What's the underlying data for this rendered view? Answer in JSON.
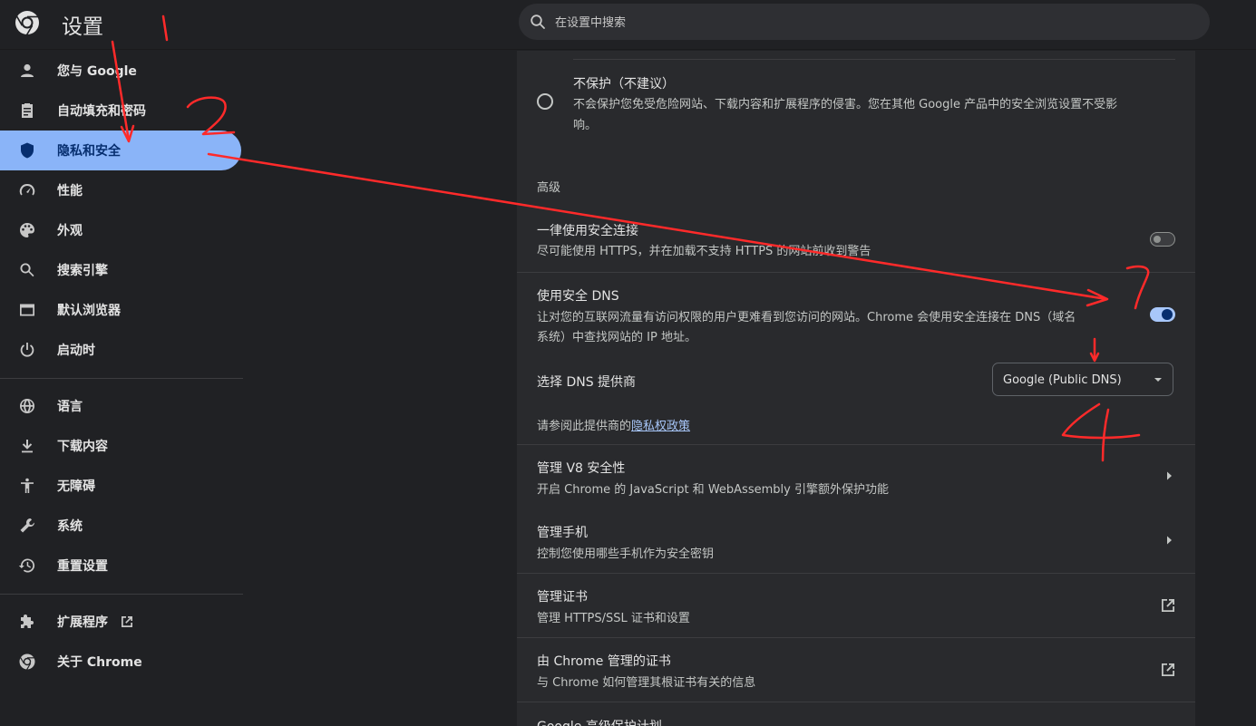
{
  "app": {
    "title": "设置"
  },
  "search": {
    "placeholder": "在设置中搜索"
  },
  "sidebar": {
    "items": [
      {
        "label": "您与 Google",
        "icon": "person-icon"
      },
      {
        "label": "自动填充和密码",
        "icon": "clipboard-icon"
      },
      {
        "label": "隐私和安全",
        "icon": "shield-icon",
        "active": true
      },
      {
        "label": "性能",
        "icon": "speedometer-icon"
      },
      {
        "label": "外观",
        "icon": "palette-icon"
      },
      {
        "label": "搜索引擎",
        "icon": "search-icon"
      },
      {
        "label": "默认浏览器",
        "icon": "browser-window-icon"
      },
      {
        "label": "启动时",
        "icon": "power-icon"
      }
    ],
    "items2": [
      {
        "label": "语言",
        "icon": "globe-icon"
      },
      {
        "label": "下载内容",
        "icon": "download-icon"
      },
      {
        "label": "无障碍",
        "icon": "accessibility-icon"
      },
      {
        "label": "系统",
        "icon": "wrench-icon"
      },
      {
        "label": "重置设置",
        "icon": "history-icon"
      }
    ],
    "items3": [
      {
        "label": "扩展程序",
        "icon": "puzzle-icon"
      },
      {
        "label": "关于 Chrome",
        "icon": "chrome-icon"
      }
    ]
  },
  "content": {
    "no_protection": {
      "title": "不保护（不建议）",
      "desc_line1": "不会保护您免受危险网站、下载内容和扩展程序的侵害。您在其他 Google 产品中的安全浏览设置不受影",
      "desc_line2": "响。"
    },
    "advanced_heading": "高级",
    "https_only": {
      "title": "一律使用安全连接",
      "desc": "尽可能使用 HTTPS，并在加载不支持 HTTPS 的网站前收到警告",
      "enabled": false
    },
    "secure_dns": {
      "title": "使用安全 DNS",
      "desc_line1": "让对您的互联网流量有访问权限的用户更难看到您访问的网站。Chrome 会使用安全连接在 DNS（域名",
      "desc_line2": "系统）中查找网站的 IP 地址。",
      "enabled": true
    },
    "dns_provider": {
      "label": "选择 DNS 提供商",
      "selected": "Google (Public DNS)",
      "privacy_prefix": "请参阅此提供商的",
      "privacy_link": "隐私权政策"
    },
    "v8": {
      "title": "管理 V8 安全性",
      "desc": "开启 Chrome 的 JavaScript 和 WebAssembly 引擎额外保护功能"
    },
    "phones": {
      "title": "管理手机",
      "desc": "控制您使用哪些手机作为安全密钥"
    },
    "certs": {
      "title": "管理证书",
      "desc": "管理 HTTPS/SSL 证书和设置"
    },
    "chrome_certs": {
      "title": "由 Chrome 管理的证书",
      "desc": "与 Chrome 如何管理其根证书有关的信息"
    },
    "advanced_protection": {
      "title": "Google 高级保护计划"
    }
  },
  "colors": {
    "background": "#202124",
    "panel": "#292a2d",
    "accent": "#8ab4f8",
    "annotation": "#ff2a2a"
  }
}
